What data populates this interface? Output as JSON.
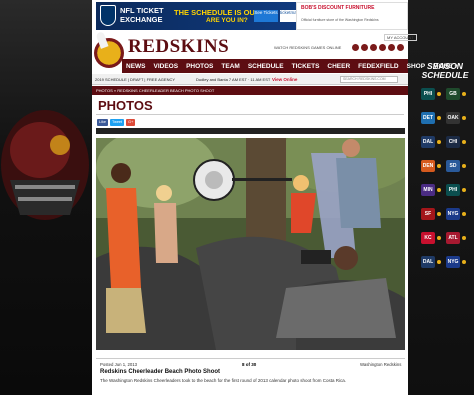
{
  "ads": {
    "nfl_line1": "NFL TICKET",
    "nfl_line2": "EXCHANGE",
    "nfl_headline": "THE SCHEDULE IS OUT",
    "nfl_sub": "ARE YOU IN?",
    "nfl_button": "See Tickets",
    "nfl_badge": "ticketmaster verified",
    "bobs_logo": "BOB'S DISCOUNT FURNITURE",
    "bobs_sub": "Official furniture store of the Washington Redskins"
  },
  "header": {
    "brand": "REDSKINS",
    "watch_link": "WATCH REDSKINS GAMES ONLINE",
    "my_account": "MY ACCOUNT",
    "brand_color": "#5d0d12",
    "gold": "#e8b01a"
  },
  "nav": [
    "NEWS",
    "VIDEOS",
    "PHOTOS",
    "TEAM",
    "SCHEDULE",
    "TICKETS",
    "CHEER",
    "FEDEXFIELD",
    "SHOP",
    "MORE +"
  ],
  "subnav": {
    "left": "2019 SCHEDULE | DRAFT | FREE AGENCY",
    "mid": "Dudley and Banta 7 AM EST · 11 AM EST",
    "live": "View Online",
    "search_placeholder": "SEARCH REDSKINS.COM"
  },
  "breadcrumb": "PHOTOS » REDSKINS CHEERLEADER BEACH PHOTO SHOOT",
  "page": {
    "title": "PHOTOS",
    "share": {
      "facebook": "Like",
      "twitter": "Tweet",
      "google": "G+"
    }
  },
  "caption": {
    "posted": "Posted Jun 1, 2013",
    "counter": "8 of 30",
    "source": "Washington Redskins",
    "title": "Redskins Cheerleader Beach Photo Shoot",
    "text": "The Washington Redskins Cheerleaders took to the beach for the first round of 2013 calendar photo shoot from Costa Rica."
  },
  "sidebar": {
    "title_line1": "SEASON",
    "title_line2": "SCHEDULE",
    "games": [
      {
        "team": "PHI",
        "color": "#0b4f4f"
      },
      {
        "team": "GB",
        "color": "#1f4a2c"
      },
      {
        "team": "DET",
        "color": "#1f6fb0"
      },
      {
        "team": "OAK",
        "color": "#333333"
      },
      {
        "team": "DAL",
        "color": "#1f3a66"
      },
      {
        "team": "CHI",
        "color": "#1b2a44"
      },
      {
        "team": "DEN",
        "color": "#d55a1e"
      },
      {
        "team": "SD",
        "color": "#2a5a9a"
      },
      {
        "team": "MIN",
        "color": "#4b2c83"
      },
      {
        "team": "PHI",
        "color": "#0b4f4f"
      },
      {
        "team": "SF",
        "color": "#a4161a"
      },
      {
        "team": "NYG",
        "color": "#1b3a8a"
      },
      {
        "team": "KC",
        "color": "#c8102e"
      },
      {
        "team": "ATL",
        "color": "#a71930"
      },
      {
        "team": "DAL",
        "color": "#1f3a66"
      },
      {
        "team": "NYG",
        "color": "#1b3a8a"
      }
    ]
  }
}
